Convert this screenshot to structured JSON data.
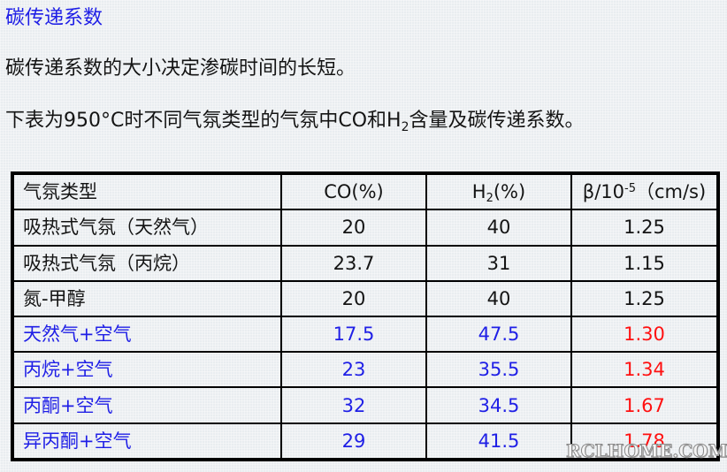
{
  "title": "碳传递系数",
  "paragraphs": {
    "p1": "碳传递系数的大小决定渗碳时间的长短。",
    "p2_before": "下表为950°C时不同气氛类型的气氛中CO和H",
    "p2_sub": "2",
    "p2_after": "含量及碳传递系数。"
  },
  "table": {
    "headers": {
      "type": "气氛类型",
      "co": "CO(%)",
      "h2_base": "H",
      "h2_sub": "2",
      "h2_suffix": "(%)",
      "beta_base": "β/10",
      "beta_sup": "-5",
      "beta_suffix": "（cm/s)"
    },
    "rows": [
      {
        "type": "吸热式气氛（天然气）",
        "co": "20",
        "h2": "40",
        "beta": "1.25",
        "style": "black"
      },
      {
        "type": "吸热式气氛（丙烷）",
        "co": "23.7",
        "h2": "31",
        "beta": "1.15",
        "style": "black"
      },
      {
        "type": "氮-甲醇",
        "co": "20",
        "h2": "40",
        "beta": "1.25",
        "style": "black"
      },
      {
        "type": "天然气+空气",
        "co": "17.5",
        "h2": "47.5",
        "beta": "1.30",
        "style": "highlight"
      },
      {
        "type": "丙烷+空气",
        "co": "23",
        "h2": "35.5",
        "beta": "1.34",
        "style": "highlight"
      },
      {
        "type": "丙酮+空气",
        "co": "32",
        "h2": "34.5",
        "beta": "1.67",
        "style": "highlight"
      },
      {
        "type": "异丙酮+空气",
        "co": "29",
        "h2": "41.5",
        "beta": "1.78",
        "style": "highlight"
      }
    ]
  },
  "colors": {
    "title": "#1f1fe6",
    "highlight_text": "#1f1fe6",
    "highlight_beta": "#ff1010",
    "border": "#000000"
  },
  "watermark": "RCLHOME.COM"
}
